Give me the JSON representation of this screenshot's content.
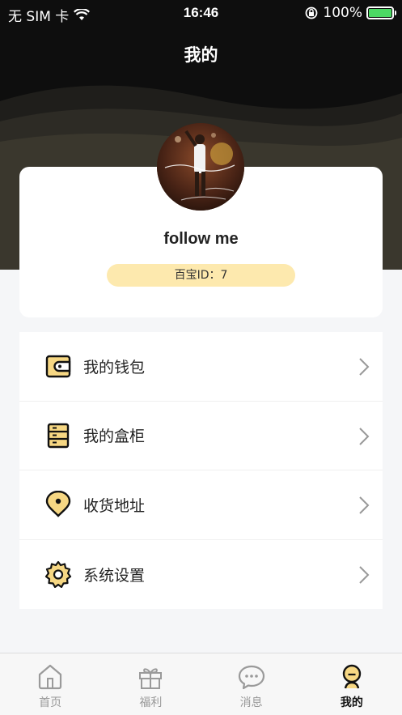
{
  "status_bar": {
    "carrier": "无 SIM 卡",
    "time": "16:46",
    "battery": "100%",
    "battery_level": 1.0
  },
  "header": {
    "title": "我的"
  },
  "profile": {
    "avatar_icon": "avatar-photo",
    "username": "follow me",
    "id_text": "百宝ID：7"
  },
  "menu": {
    "items": [
      {
        "label": "我的钱包",
        "icon": "wallet-icon"
      },
      {
        "label": "我的盒柜",
        "icon": "cabinet-icon"
      },
      {
        "label": "收货地址",
        "icon": "location-icon"
      },
      {
        "label": "系统设置",
        "icon": "settings-icon"
      }
    ]
  },
  "tabbar": {
    "tabs": [
      {
        "label": "首页",
        "icon": "home-icon",
        "active": false
      },
      {
        "label": "福利",
        "icon": "gift-icon",
        "active": false
      },
      {
        "label": "消息",
        "icon": "message-icon",
        "active": false
      },
      {
        "label": "我的",
        "icon": "profile-icon",
        "active": true
      }
    ]
  },
  "colors": {
    "accent": "#fde9ae",
    "icon_fill": "#f6d783",
    "header_bg": "#0e0e0e",
    "battery": "#4cd964"
  }
}
